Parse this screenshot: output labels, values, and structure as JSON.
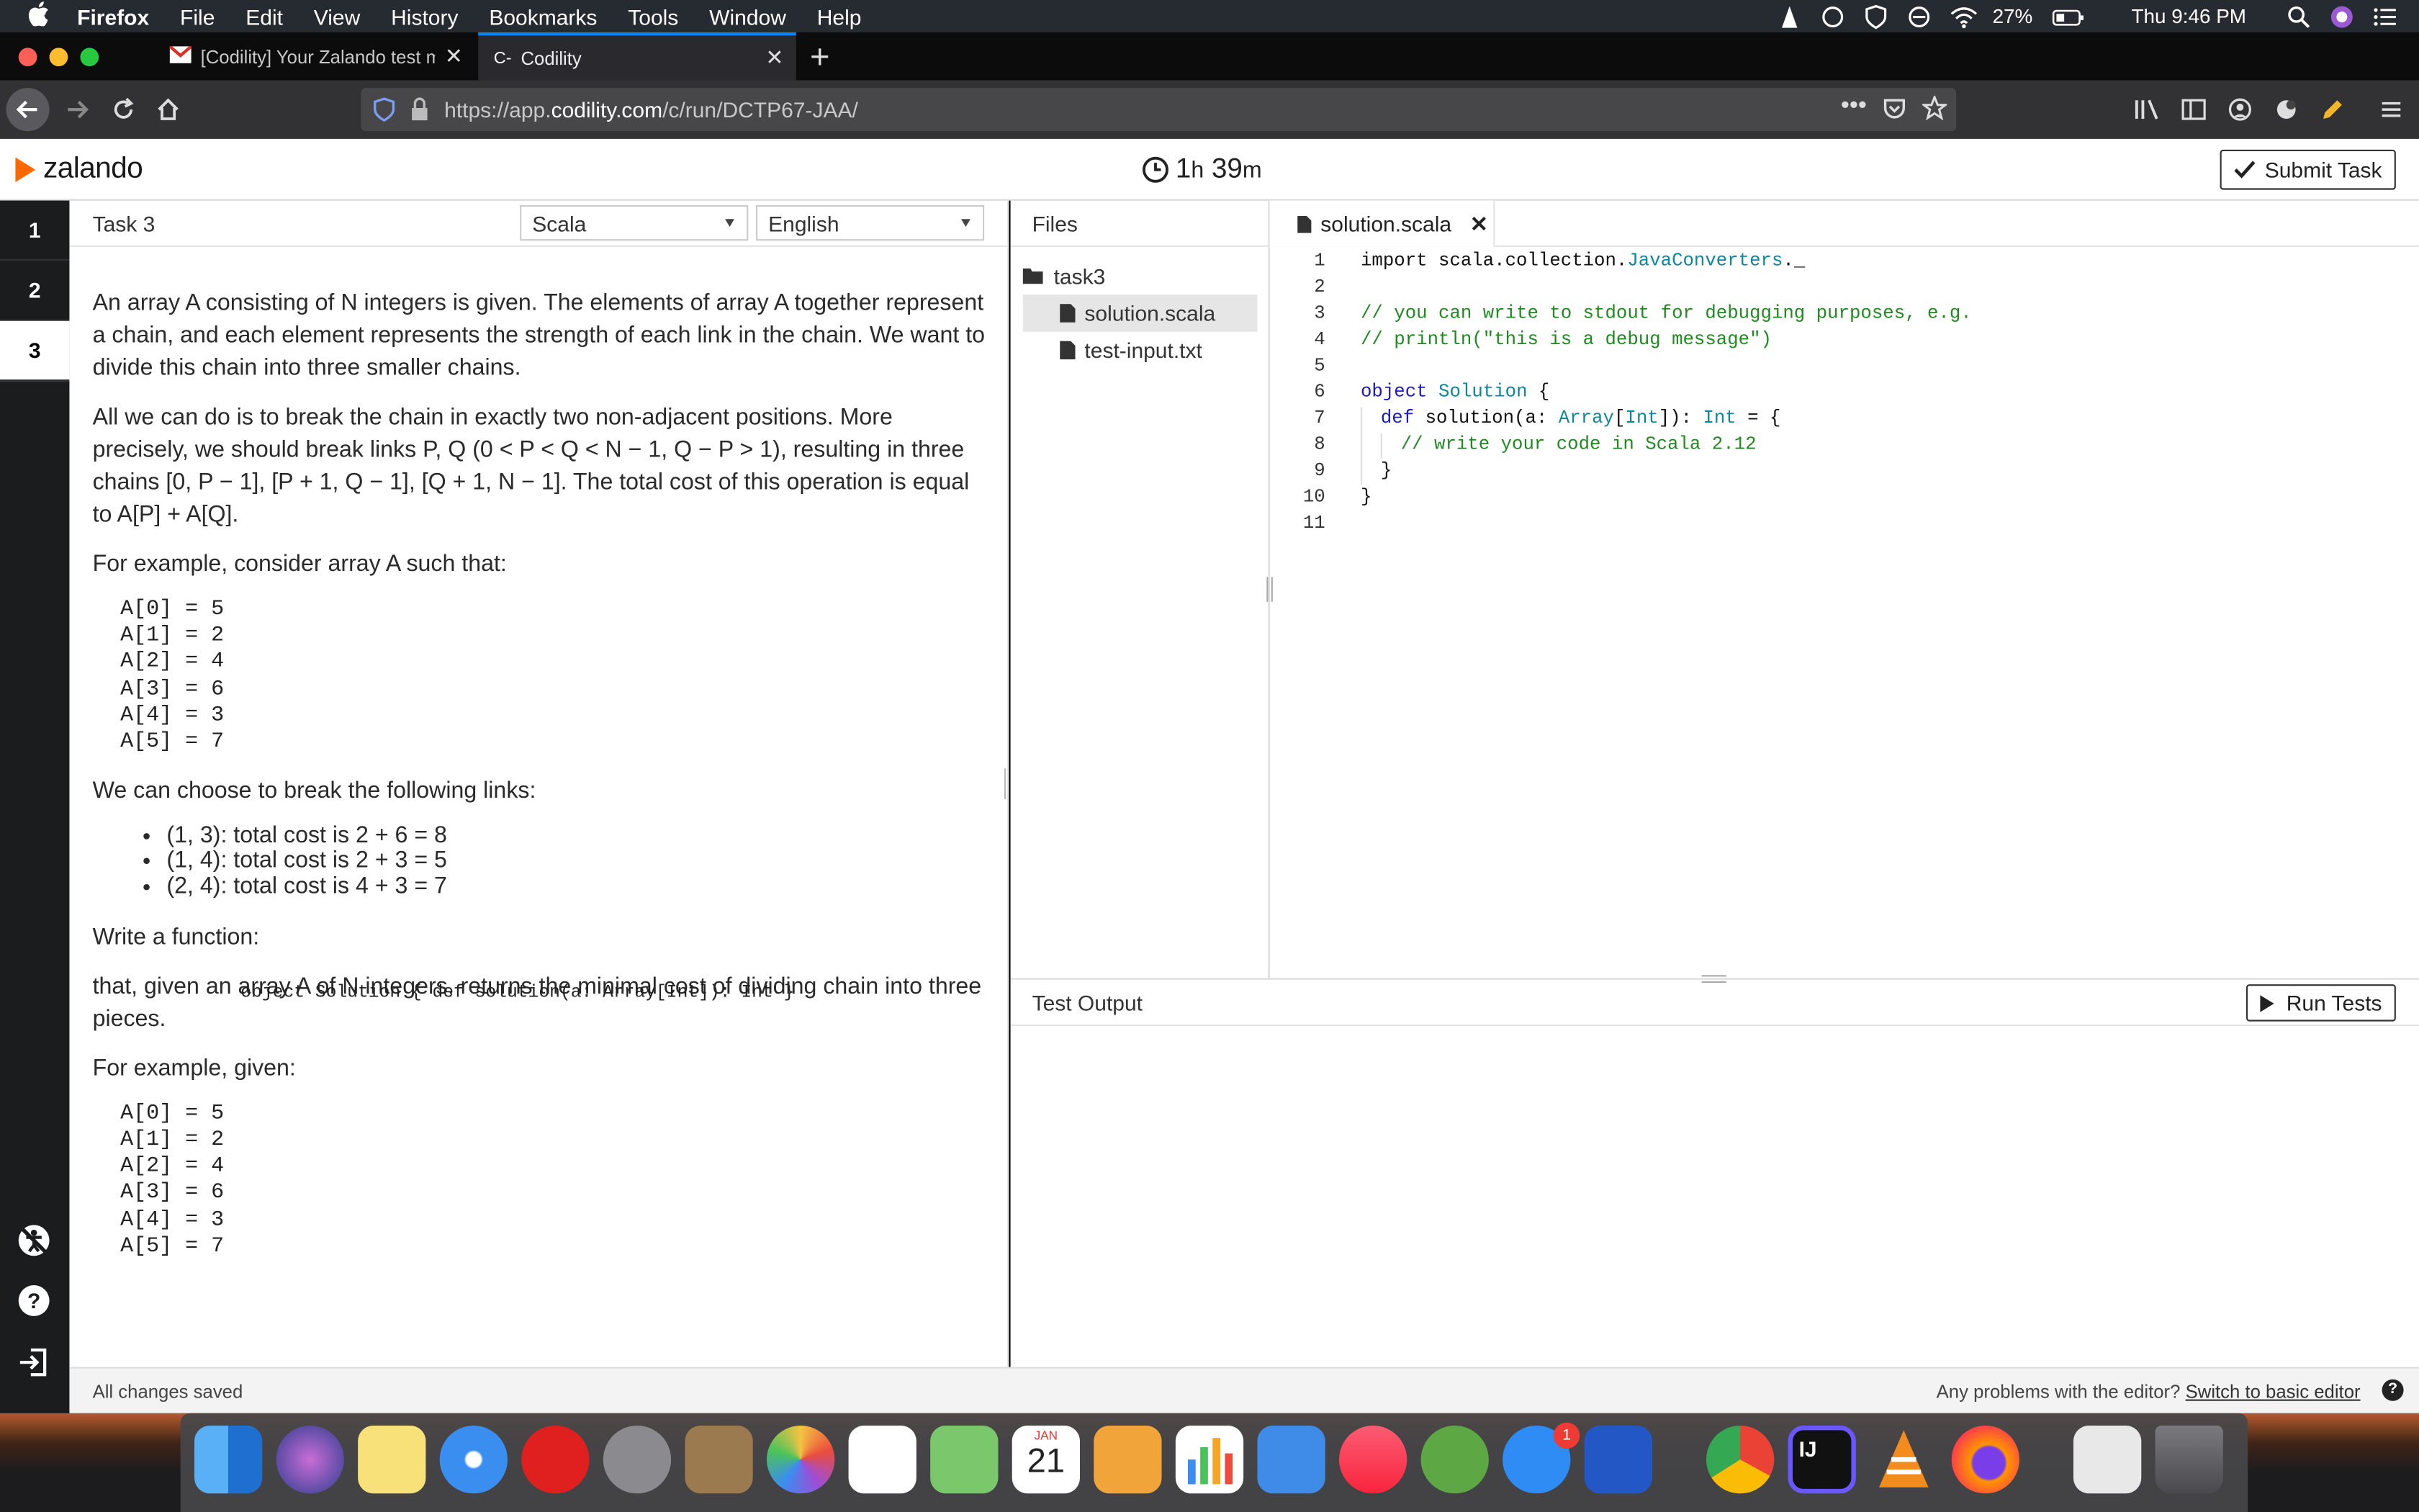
{
  "menubar": {
    "app": "Firefox",
    "items": [
      "File",
      "Edit",
      "View",
      "History",
      "Bookmarks",
      "Tools",
      "Window",
      "Help"
    ],
    "battery": "27%",
    "clock": "Thu 9:46 PM"
  },
  "tabs": [
    {
      "label": "[Codility] Your Zalando test mis"
    },
    {
      "label": "Codility"
    }
  ],
  "url": {
    "prefix": "https://app.",
    "domain": "codility.com",
    "path": "/c/run/DCTP67-JAA/"
  },
  "header": {
    "brand": "zalando",
    "timer_hours": "1",
    "timer_h": "h",
    "timer_minutes": "39",
    "timer_m": "m",
    "submit_label": "Submit Task"
  },
  "task_nav": [
    "1",
    "2",
    "3"
  ],
  "task": {
    "title": "Task 3",
    "language": "Scala",
    "locale": "English",
    "p1": "An array A consisting of N integers is given. The elements of array A together represent a chain, and each element represents the strength of each link in the chain. We want to divide this chain into three smaller chains.",
    "p2": "All we can do is to break the chain in exactly two non-adjacent positions. More precisely, we should break links P, Q (0 < P < Q < N − 1, Q − P > 1), resulting in three chains [0, P − 1], [P + 1, Q − 1], [Q + 1, N − 1]. The total cost of this operation is equal to A[P] + A[Q].",
    "p3": "For example, consider array A such that:",
    "array1": "A[0] = 5\nA[1] = 2\nA[2] = 4\nA[3] = 6\nA[4] = 3\nA[5] = 7",
    "p4": "We can choose to break the following links:",
    "bullets": [
      "(1, 3): total cost is 2 + 6 = 8",
      "(1, 4): total cost is 2 + 3 = 5",
      "(2, 4): total cost is 4 + 3 = 7"
    ],
    "p5": "Write a function:",
    "signature": "object Solution { def solution(a: Array[Int]): Int }",
    "p6": "that, given an array A of N integers, returns the minimal cost of dividing chain into three pieces.",
    "p7": "For example, given:",
    "array2": "A[0] = 5\nA[1] = 2\nA[2] = 4\nA[3] = 6\nA[4] = 3\nA[5] = 7"
  },
  "files": {
    "header": "Files",
    "folder": "task3",
    "items": [
      "solution.scala",
      "test-input.txt"
    ]
  },
  "editor": {
    "tab": "solution.scala",
    "lines": [
      "1",
      "2",
      "3",
      "4",
      "5",
      "6",
      "7",
      "8",
      "9",
      "10",
      "11"
    ],
    "code": {
      "l1a": "import scala.collection.",
      "l1b": "JavaConverters",
      "l1c": "._",
      "l3": "// you can write to stdout for debugging purposes, e.g.",
      "l4": "// println(\"this is a debug message\")",
      "l6a": "object",
      "l6b": "Solution",
      "l6c": " {",
      "l7a": "def",
      "l7b": " solution(a: ",
      "l7c": "Array",
      "l7d": "[",
      "l7e": "Int",
      "l7f": "]): ",
      "l7g": "Int",
      "l7h": " = {",
      "l8": "// write your code in Scala 2.12",
      "l9": "}",
      "l10": "}"
    }
  },
  "test_output": {
    "title": "Test Output",
    "run_label": "Run Tests"
  },
  "status": {
    "saved": "All changes saved",
    "problems": "Any problems with the editor?",
    "switch": "Switch to basic editor"
  },
  "dock": {
    "calendar_month": "JAN",
    "calendar_day": "21",
    "badge": "1"
  }
}
